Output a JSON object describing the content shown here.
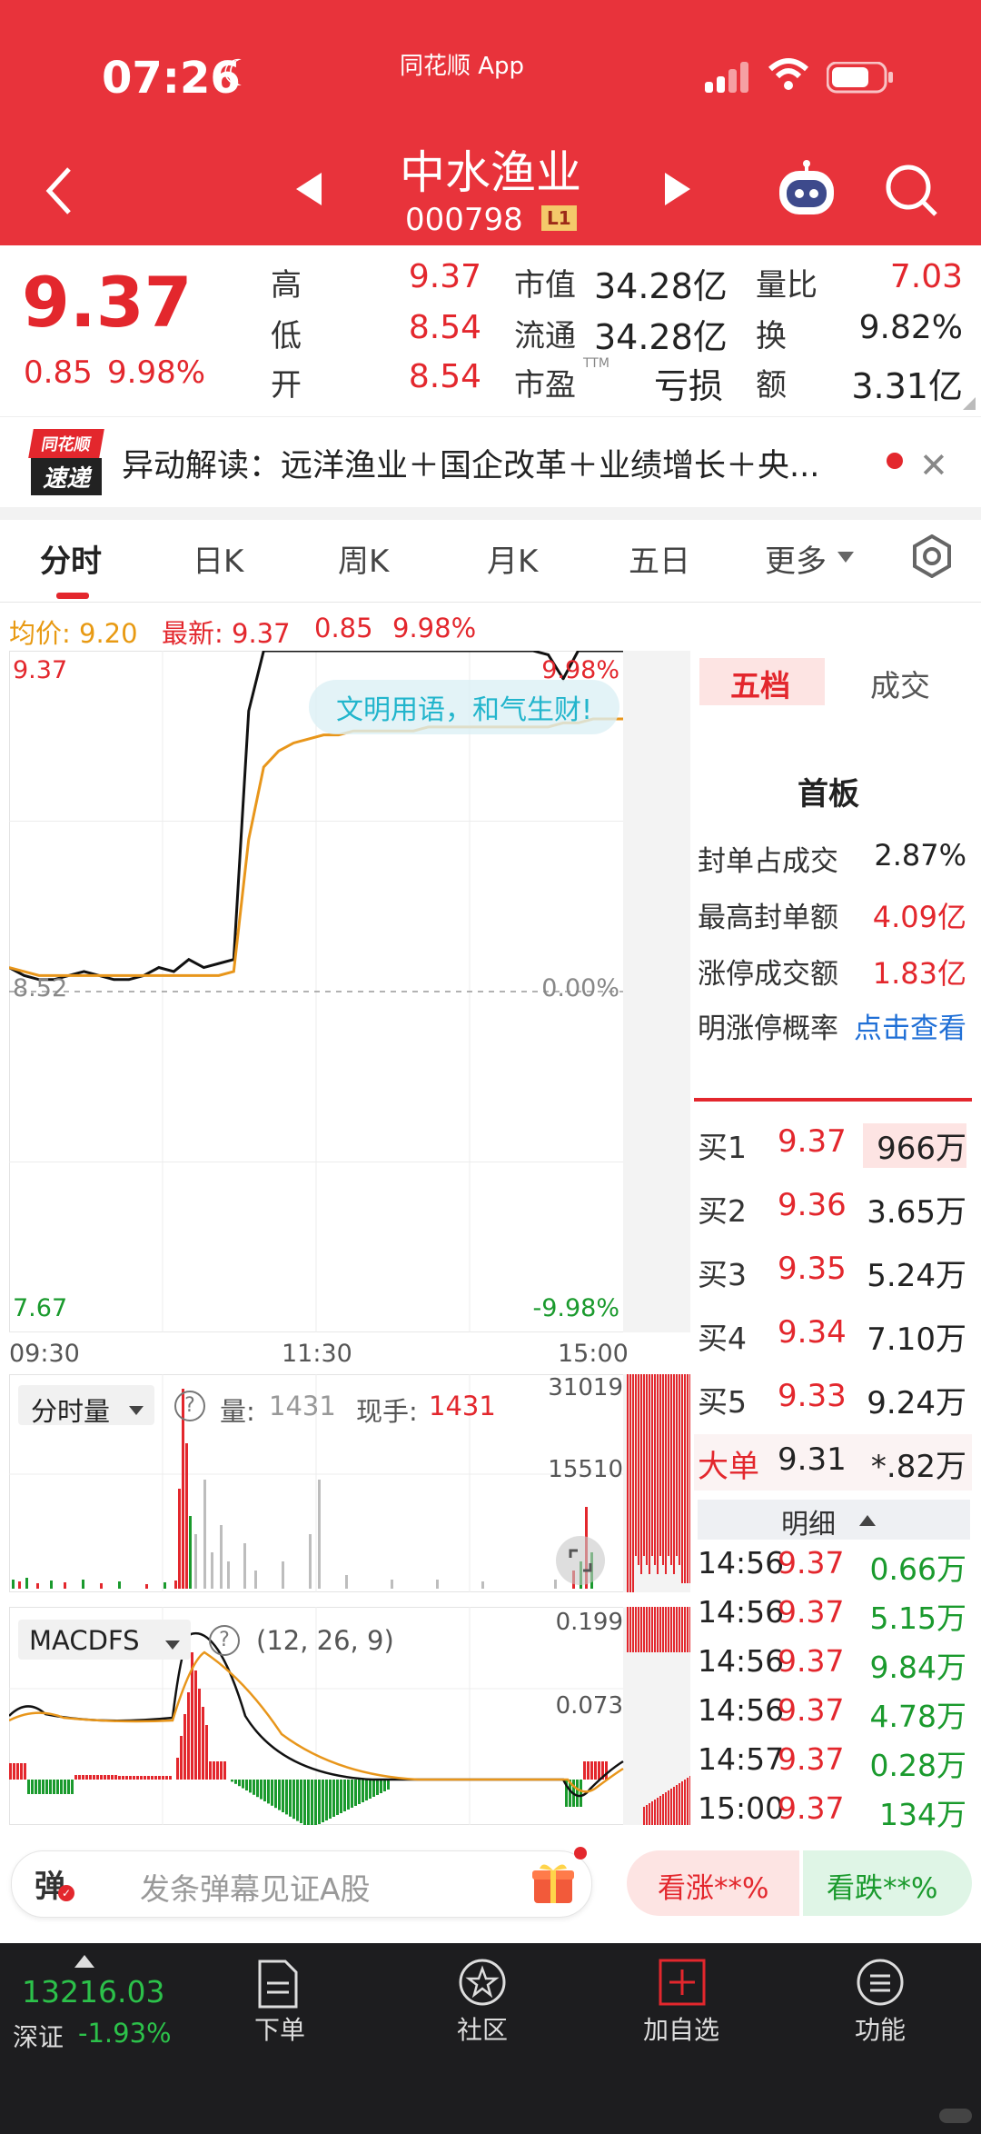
{
  "status_bar": {
    "time": "07:26",
    "app_name": "同花顺 App"
  },
  "header": {
    "stock_name": "中水渔业",
    "stock_code": "000798",
    "level_badge": "L1"
  },
  "quote": {
    "price": "9.37",
    "change": "0.85",
    "change_pct": "9.98%",
    "rows": [
      {
        "l1": "高",
        "v1": "9.37",
        "l2": "市值",
        "v2": "34.28亿",
        "l3": "量比",
        "v3": "7.03"
      },
      {
        "l1": "低",
        "v1": "8.54",
        "l2": "流通",
        "v2": "34.28亿",
        "l3": "换",
        "v3": "9.82%"
      },
      {
        "l1": "开",
        "v1": "8.54",
        "l2": "市盈",
        "v2": "亏损",
        "l3": "额",
        "v3": "3.31亿"
      }
    ],
    "pe_suffix": "TTM"
  },
  "news": {
    "badge_top": "同花顺",
    "badge_bottom": "速递",
    "text": "异动解读：远洋渔业＋国企改革＋业绩增长＋央..."
  },
  "tabs": [
    "分时",
    "日K",
    "周K",
    "月K",
    "五日",
    "更多"
  ],
  "price_line": {
    "avg_label": "均价: 9.20",
    "latest_label": "最新: 9.37",
    "change": "0.85",
    "change_pct": "9.98%"
  },
  "chart_data": {
    "type": "line",
    "y_labels_left": {
      "top": "9.37",
      "mid": "8.52",
      "bottom": "7.67"
    },
    "y_labels_right": {
      "top": "9.98%",
      "mid": "0.00%",
      "bottom": "-9.98%"
    },
    "x_labels": [
      "09:30",
      "11:30",
      "15:00"
    ],
    "ylim": [
      7.67,
      9.37
    ],
    "series": [
      {
        "values": [
          8.58,
          8.56,
          8.55,
          8.55,
          8.56,
          8.57,
          8.56,
          8.55,
          8.55,
          8.56,
          8.58,
          8.57,
          8.6,
          8.58,
          8.59,
          8.6,
          9.22,
          9.37,
          9.37,
          9.37,
          9.37,
          9.37,
          9.37,
          9.37,
          9.37,
          9.37,
          9.37,
          9.37,
          9.37,
          9.37,
          9.37,
          9.37,
          9.37,
          9.37,
          9.37,
          9.37,
          9.36,
          9.3,
          9.37,
          9.37,
          9.37,
          9.37
        ]
      },
      {
        "values": [
          8.58,
          8.57,
          8.56,
          8.56,
          8.56,
          8.56,
          8.56,
          8.56,
          8.56,
          8.56,
          8.56,
          8.56,
          8.56,
          8.56,
          8.56,
          8.57,
          8.9,
          9.08,
          9.12,
          9.14,
          9.15,
          9.16,
          9.16,
          9.17,
          9.17,
          9.17,
          9.17,
          9.17,
          9.18,
          9.18,
          9.18,
          9.18,
          9.18,
          9.18,
          9.18,
          9.18,
          9.18,
          9.19,
          9.19,
          9.2,
          9.2,
          9.2
        ]
      }
    ],
    "watermark": "文明用语，和气生财!"
  },
  "side_panel": {
    "tabs": [
      "五档",
      "成交"
    ],
    "title": "首板",
    "stats": [
      {
        "label": "封单占成交",
        "value": "2.87%"
      },
      {
        "label": "最高封单额",
        "value": "4.09亿"
      },
      {
        "label": "涨停成交额",
        "value": "1.83亿"
      },
      {
        "label": "明涨停概率",
        "value": "点击查看"
      }
    ],
    "bids": [
      {
        "label": "买1",
        "price": "9.37",
        "vol": "966万"
      },
      {
        "label": "买2",
        "price": "9.36",
        "vol": "3.65万"
      },
      {
        "label": "买3",
        "price": "9.35",
        "vol": "5.24万"
      },
      {
        "label": "买4",
        "price": "9.34",
        "vol": "7.10万"
      },
      {
        "label": "买5",
        "price": "9.33",
        "vol": "9.24万"
      }
    ],
    "big_order": {
      "label": "大单",
      "price": "9.31",
      "vol": "*.82万"
    },
    "detail_label": "明细",
    "trades": [
      {
        "time": "14:56",
        "price": "9.37",
        "vol": "0.66万"
      },
      {
        "time": "14:56",
        "price": "9.37",
        "vol": "5.15万"
      },
      {
        "time": "14:56",
        "price": "9.37",
        "vol": "9.84万"
      },
      {
        "time": "14:56",
        "price": "9.37",
        "vol": "4.78万"
      },
      {
        "time": "14:57",
        "price": "9.37",
        "vol": "0.28万"
      },
      {
        "time": "15:00",
        "price": "9.37",
        "vol": "134万"
      }
    ]
  },
  "volume_panel": {
    "selector": "分时量",
    "vol_label": "量:",
    "vol_value": "1431",
    "hand_label": "现手:",
    "hand_value": "1431",
    "y_top": "31019",
    "y_mid": "15510"
  },
  "macd_panel": {
    "selector": "MACDFS",
    "params": "(12, 26, 9)",
    "y_top": "0.199",
    "y_mid": "0.073"
  },
  "danmu": {
    "placeholder": "发条弹幕见证A股",
    "up_btn": "看涨**%",
    "down_btn": "看跌**%",
    "icon_char": "弹"
  },
  "bottom_nav": {
    "index_value": "13216.03",
    "index_name": "深证",
    "index_change": "-1.93%",
    "items": [
      "下单",
      "社区",
      "加自选",
      "功能"
    ]
  }
}
